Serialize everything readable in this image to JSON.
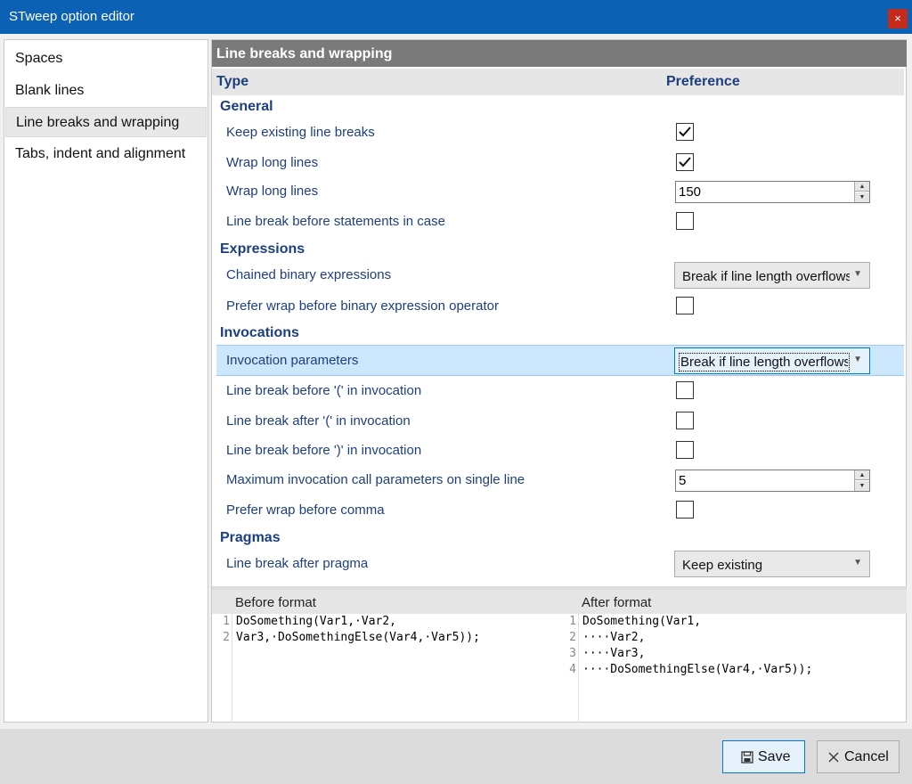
{
  "window": {
    "title": "STweep option editor",
    "close_glyph": "×"
  },
  "sidebar": {
    "items": [
      {
        "label": "Spaces"
      },
      {
        "label": "Blank lines"
      },
      {
        "label": "Line breaks and wrapping",
        "selected": true
      },
      {
        "label": "Tabs, indent and alignment"
      }
    ]
  },
  "main": {
    "section_title": "Line breaks and wrapping",
    "columns": {
      "type": "Type",
      "preference": "Preference"
    },
    "groups": {
      "general": "General",
      "expressions": "Expressions",
      "invocations": "Invocations",
      "pragmas": "Pragmas"
    },
    "rows": [
      {
        "label": "Keep existing line breaks",
        "kind": "checkbox",
        "checked": true
      },
      {
        "label": "Wrap long lines",
        "kind": "checkbox",
        "checked": true
      },
      {
        "label": "Wrap long lines",
        "kind": "spin",
        "value": "150"
      },
      {
        "label": "Line break before statements in case",
        "kind": "checkbox",
        "checked": false
      },
      {
        "label": "Chained binary expressions",
        "kind": "combo",
        "value": "Break if line length overflows"
      },
      {
        "label": "Prefer wrap before binary expression operator",
        "kind": "checkbox",
        "checked": false
      },
      {
        "label": "Invocation parameters",
        "kind": "combo",
        "value": "Break if line length overflows",
        "selected": true
      },
      {
        "label": "Line break before '(' in invocation",
        "kind": "checkbox",
        "checked": false
      },
      {
        "label": "Line break after '(' in invocation",
        "kind": "checkbox",
        "checked": false
      },
      {
        "label": "Line break before ')' in invocation",
        "kind": "checkbox",
        "checked": false
      },
      {
        "label": "Maximum invocation call parameters on single line",
        "kind": "spin",
        "value": "5"
      },
      {
        "label": "Prefer wrap before comma",
        "kind": "checkbox",
        "checked": false
      },
      {
        "label": "Line break after pragma",
        "kind": "combo",
        "value": "Keep existing"
      }
    ]
  },
  "preview": {
    "before": {
      "title": "Before format",
      "line_numbers": [
        "1",
        "2"
      ],
      "lines": [
        "DoSomething(Var1,·Var2,",
        "Var3,·DoSomethingElse(Var4,·Var5));"
      ]
    },
    "after": {
      "title": "After format",
      "line_numbers": [
        "1",
        "2",
        "3",
        "4"
      ],
      "lines": [
        "DoSomething(Var1,",
        "····Var2,",
        "····Var3,",
        "····DoSomethingElse(Var4,·Var5));"
      ]
    }
  },
  "footer": {
    "save_label": "Save",
    "cancel_label": "Cancel"
  },
  "colors": {
    "titlebar": "#0b62b5",
    "accent_text": "#1c3f80",
    "selection": "#cce6fb",
    "close": "#c42b1c"
  }
}
